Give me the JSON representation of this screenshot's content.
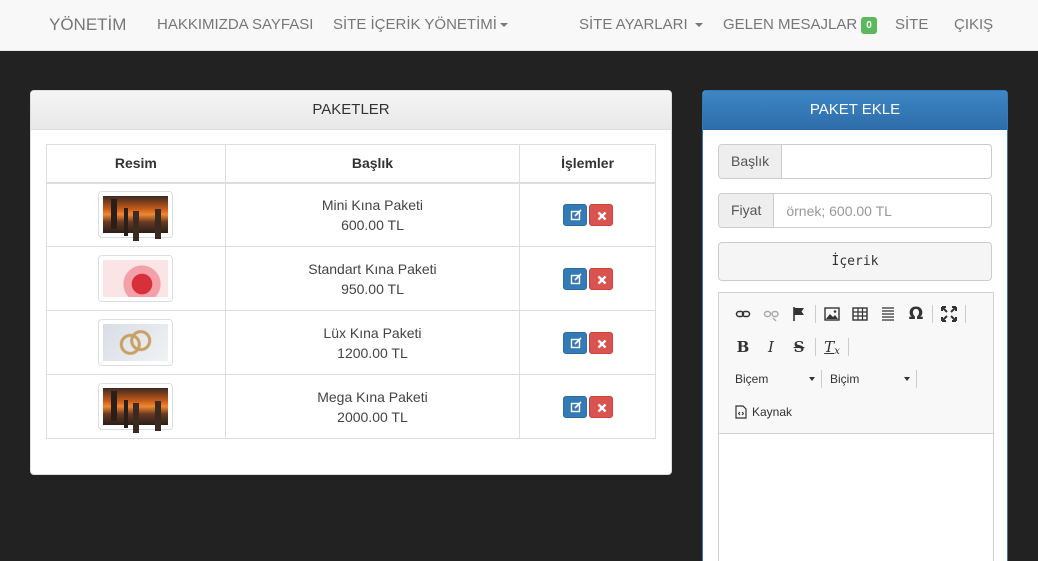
{
  "navbar": {
    "brand": "YÖNETİM",
    "about": "HAKKIMIZDA SAYFASI",
    "content_mgmt": "SİTE İÇERİK YÖNETİMİ",
    "site_settings": "SİTE AYARLARI",
    "messages": "GELEN MESAJLAR",
    "messages_count": "0",
    "site": "SİTE",
    "logout": "ÇIKIŞ"
  },
  "packages_panel": {
    "title": "PAKETLER",
    "columns": [
      "Resim",
      "Başlık",
      "İşlemler"
    ],
    "rows": [
      {
        "name": "Mini Kına Paketi",
        "price": "600.00 TL",
        "image": "city-sunset"
      },
      {
        "name": "Standart Kına Paketi",
        "price": "950.00 TL",
        "image": "flowers"
      },
      {
        "name": "Lüx Kına Paketi",
        "price": "1200.00 TL",
        "image": "rings"
      },
      {
        "name": "Mega Kına Paketi",
        "price": "2000.00 TL",
        "image": "city-sunset"
      }
    ]
  },
  "add_panel": {
    "title": "PAKET EKLE",
    "title_label": "Başlık",
    "title_value": "",
    "price_label": "Fiyat",
    "price_placeholder": "örnek; 600.00 TL",
    "content_button": "İçerik",
    "editor": {
      "format_combo": "Biçem",
      "style_combo": "Biçim",
      "source_label": "Kaynak"
    }
  },
  "colors": {
    "primary": "#337ab7",
    "danger": "#d9534f",
    "success": "#5cb85c",
    "background": "#222222"
  }
}
